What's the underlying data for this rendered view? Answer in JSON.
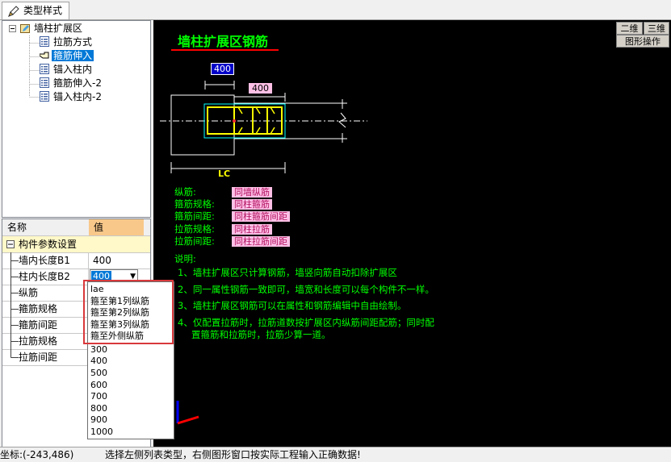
{
  "tab": {
    "label": "类型样式"
  },
  "tree": {
    "root": "墙柱扩展区",
    "children": [
      "拉筋方式",
      "箍筋伸入",
      "锚入柱内",
      "箍筋伸入-2",
      "锚入柱内-2"
    ],
    "selected_index": 1
  },
  "grid": {
    "col_name": "名称",
    "col_value": "值",
    "group": "构件参数设置",
    "rows": [
      {
        "name": "墙内长度B1",
        "value": "400"
      },
      {
        "name": "柱内长度B2",
        "value": "400"
      },
      {
        "name": "纵筋",
        "value": ""
      },
      {
        "name": "箍筋规格",
        "value": ""
      },
      {
        "name": "箍筋间距",
        "value": ""
      },
      {
        "name": "拉筋规格",
        "value": ""
      },
      {
        "name": "拉筋间距",
        "value": ""
      }
    ]
  },
  "dropdown": {
    "options": [
      "lae",
      "箍至第1列纵筋",
      "箍至第2列纵筋",
      "箍至第3列纵筋",
      "箍至外侧纵筋",
      "300",
      "400",
      "500",
      "600",
      "700",
      "800",
      "900",
      "1000"
    ]
  },
  "canvas": {
    "view_2d": "二维",
    "view_3d": "三维",
    "graph_op": "图形操作",
    "title": "墙柱扩展区钢筋",
    "dim_top": "400",
    "dim_right": "400",
    "dim_bottom": "LC",
    "props": [
      {
        "label": "纵筋:",
        "value": "同墙纵筋"
      },
      {
        "label": "箍筋规格:",
        "value": "同柱箍筋"
      },
      {
        "label": "箍筋间距:",
        "value": "同柱箍筋间距"
      },
      {
        "label": "拉筋规格:",
        "value": "同柱拉筋"
      },
      {
        "label": "拉筋间距:",
        "value": "同柱拉筋间距"
      }
    ],
    "notes_title": "说明:",
    "notes": [
      "1、墙柱扩展区只计算钢筋，墙竖向筋自动扣除扩展区",
      "2、同一属性钢筋一致即可，墙宽和长度可以每个构件不一样。",
      "3、墙柱扩展区钢筋可以在属性和钢筋编辑中自由绘制。",
      "4、仅配置拉筋时，拉筋道数按扩展区内纵筋间距配筋；同时配",
      "置箍筋和拉筋时，拉筋少算一道。"
    ]
  },
  "status": {
    "coords": "坐标:(-243,486)",
    "message": "选择左侧列表类型，右侧图形窗口按实际工程输入正确数据!"
  },
  "colors": {
    "accent": "#0078d7",
    "canvas_bg": "#000000",
    "title_green": "#00ff00",
    "highlight_red": "#d9393c"
  }
}
